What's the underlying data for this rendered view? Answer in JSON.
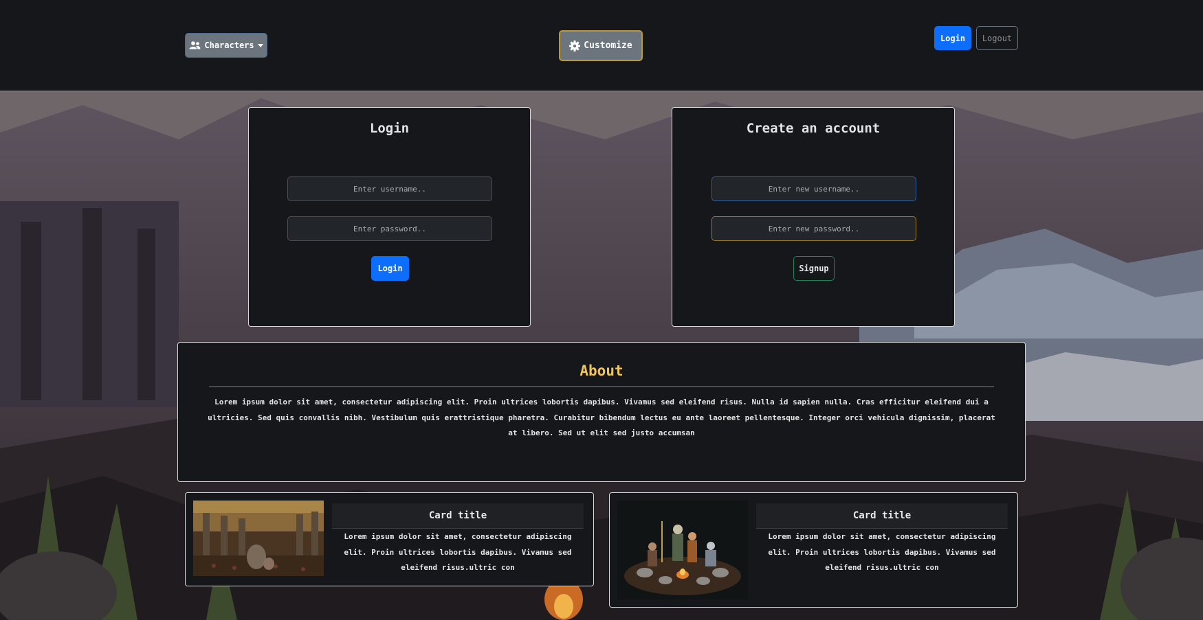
{
  "nav": {
    "characters_label": "Characters",
    "customize_label": "Customize",
    "login_label": "Login",
    "logout_label": "Logout"
  },
  "login_panel": {
    "title": "Login",
    "username_placeholder": "Enter username..",
    "password_placeholder": "Enter password..",
    "submit_label": "Login"
  },
  "signup_panel": {
    "title": "Create an account",
    "username_placeholder": "Enter new username..",
    "password_placeholder": "Enter new password..",
    "submit_label": "Signup"
  },
  "about": {
    "title": "About",
    "body": "Lorem ipsum dolor sit amet, consectetur adipiscing elit. Proin ultrices lobortis dapibus. Vivamus sed eleifend risus. Nulla id sapien nulla. Cras efficitur eleifend dui a ultricies. Sed quis convallis nibh. Vestibulum quis erattristique pharetra. Curabitur bibendum lectus eu ante laoreet pellentesque. Integer orci vehicula dignissim, placerat at libero. Sed ut elit sed justo accumsan"
  },
  "cards": [
    {
      "title": "Card title",
      "text": "Lorem ipsum dolor sit amet, consectetur adipiscing elit. Proin ultrices lobortis dapibus. Vivamus sed eleifend risus.ultric con"
    },
    {
      "title": "Card title",
      "text": "Lorem ipsum dolor sit amet, consectetur adipiscing elit. Proin ultrices lobortis dapibus. Vivamus sed eleifend risus.ultric con"
    }
  ],
  "colors": {
    "navbar_bg": "#16171a",
    "primary": "#0d6efd",
    "secondary": "#6c757d",
    "success": "#198754",
    "about_title": "#f2c55c"
  },
  "icons": {
    "characters": "users-icon",
    "customize": "gear-icon",
    "dropdown": "caret-down-icon"
  }
}
